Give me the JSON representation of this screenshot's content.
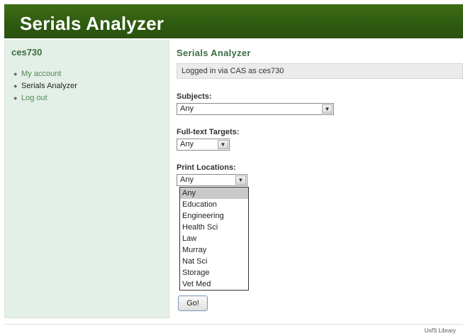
{
  "header": {
    "title": "Serials Analyzer"
  },
  "sidebar": {
    "user": "ces730",
    "items": [
      {
        "label": "My account"
      },
      {
        "label": "Serials Analyzer"
      },
      {
        "label": "Log out"
      }
    ]
  },
  "main": {
    "title": "Serials Analyzer",
    "status": "Logged in via CAS as ces730",
    "subjects": {
      "label": "Subjects:",
      "value": "Any"
    },
    "fulltext": {
      "label": "Full-text Targets:",
      "value": "Any"
    },
    "print": {
      "label": "Print Locations:",
      "value": "Any",
      "options": [
        "Any",
        "Education",
        "Engineering",
        "Health Sci",
        "Law",
        "Murray",
        "Nat Sci",
        "Storage",
        "Vet Med"
      ]
    },
    "go_label": "Go!"
  },
  "footer": {
    "text": "UofS Library"
  },
  "colors": {
    "header_green": "#2e5a10",
    "sidebar_bg": "#e4efe7",
    "accent_green": "#3b6d43"
  }
}
